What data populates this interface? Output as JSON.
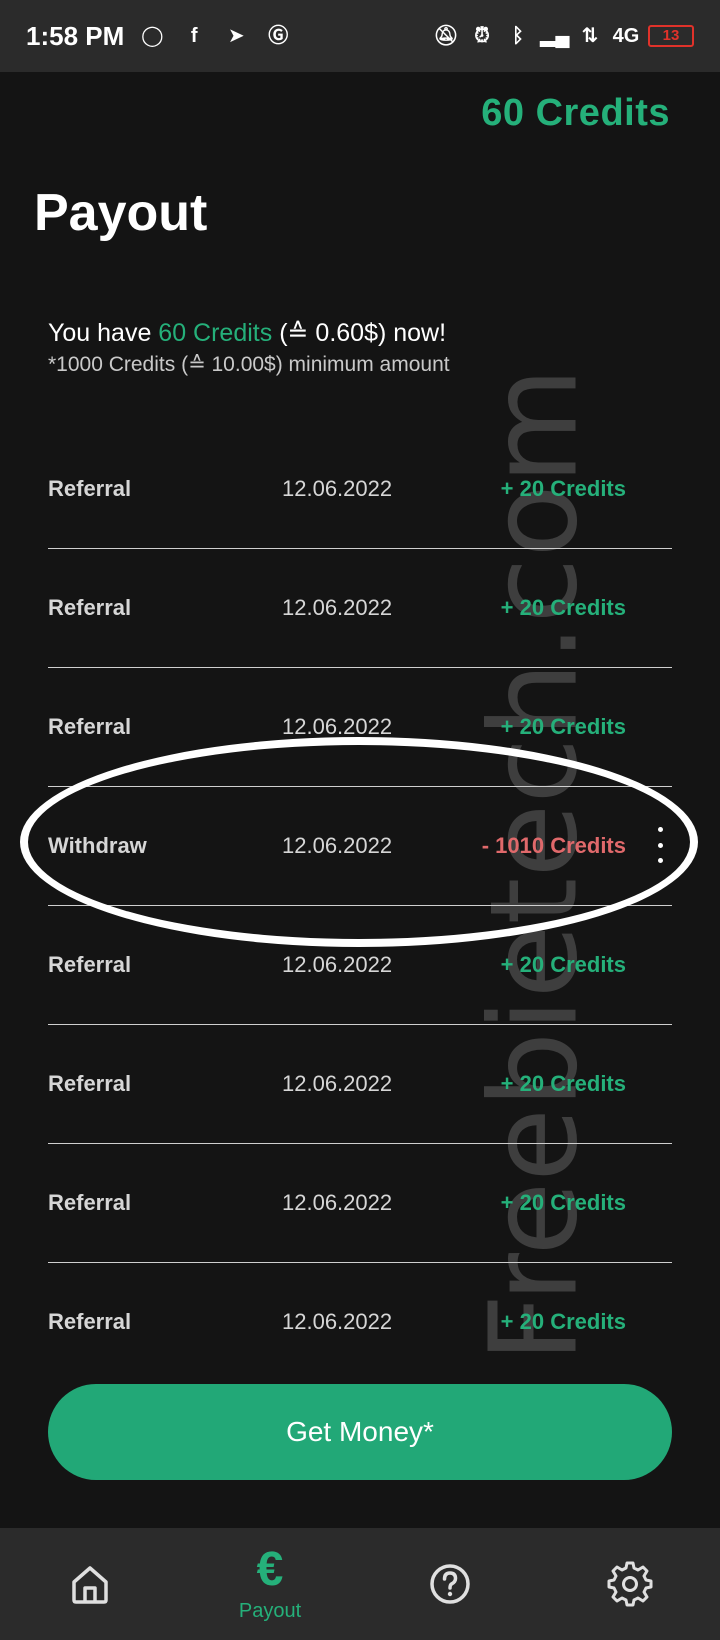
{
  "status_bar": {
    "time": "1:58 PM",
    "app_icons": [
      "whatsapp-icon",
      "facebook-icon",
      "telegram-icon",
      "g-app-icon"
    ],
    "system_icons": [
      "bell-off-icon",
      "alarm-icon",
      "bluetooth-icon",
      "signal-icon",
      "data-arrows-icon",
      "signal-4g-icon"
    ],
    "network": "4G",
    "battery": "13"
  },
  "header": {
    "credits_badge": "60 Credits",
    "title": "Payout"
  },
  "summary": {
    "prefix": "You have ",
    "credits": "60 Credits",
    "suffix": " (≙ 0.60$) now!",
    "minimum": "*1000 Credits (≙ 10.00$) minimum amount"
  },
  "transactions": [
    {
      "type": "Referral",
      "date": "12.06.2022",
      "amount": "+ 20 Credits"
    },
    {
      "type": "Referral",
      "date": "12.06.2022",
      "amount": "+ 20 Credits"
    },
    {
      "type": "Referral",
      "date": "12.06.2022",
      "amount": "+ 20 Credits"
    },
    {
      "type": "Withdraw",
      "date": "12.06.2022",
      "amount": "- 1010 Credits"
    },
    {
      "type": "Referral",
      "date": "12.06.2022",
      "amount": "+ 20 Credits"
    },
    {
      "type": "Referral",
      "date": "12.06.2022",
      "amount": "+ 20 Credits"
    },
    {
      "type": "Referral",
      "date": "12.06.2022",
      "amount": "+ 20 Credits"
    },
    {
      "type": "Referral",
      "date": "12.06.2022",
      "amount": "+ 20 Credits"
    }
  ],
  "watermark": "Freebietech.com",
  "actions": {
    "get_money_label": "Get Money*"
  },
  "nav": {
    "home_icon": "home-icon",
    "payout_icon": "euro-icon",
    "payout_glyph": "€",
    "payout_label": "Payout",
    "help_icon": "help-icon",
    "settings_icon": "gear-icon"
  },
  "colors": {
    "accent": "#25b07a",
    "negative": "#e0696b",
    "background": "#141414",
    "bar": "#2b2b2b"
  }
}
